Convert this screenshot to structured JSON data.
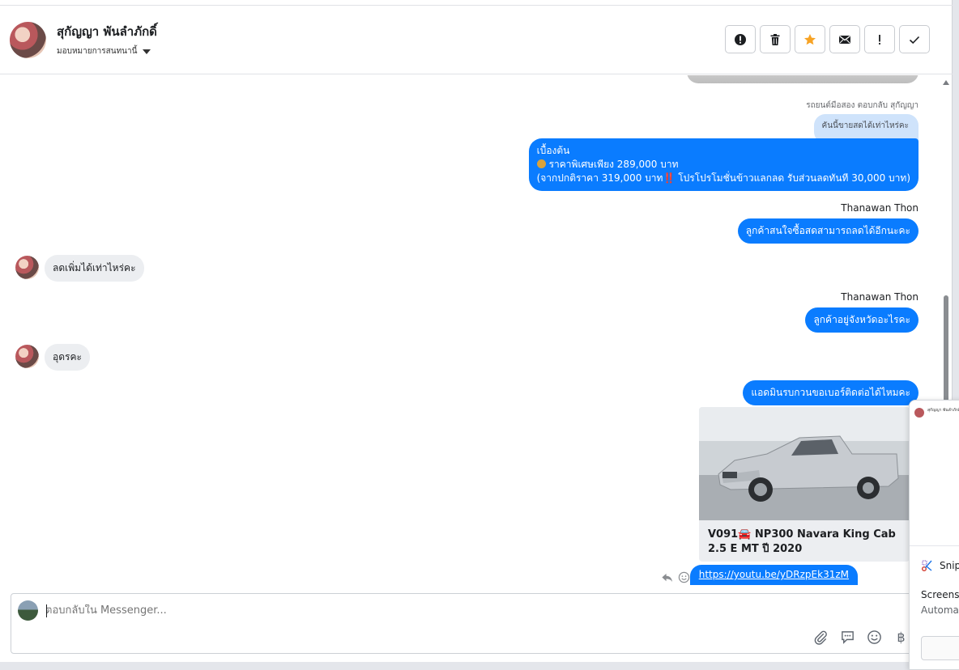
{
  "header": {
    "contact_name": "สุกัญญา พันลำภักดิ์",
    "assign_label": "มอบหมายการสนทนานี้",
    "toolbar": [
      {
        "icon": "alert-circle-icon",
        "label": "Report"
      },
      {
        "icon": "trash-icon",
        "label": "Delete"
      },
      {
        "icon": "star-icon",
        "label": "Star"
      },
      {
        "icon": "envelope-icon",
        "label": "Mark unread"
      },
      {
        "icon": "exclamation-icon",
        "label": "Follow up"
      },
      {
        "icon": "check-icon",
        "label": "Done"
      }
    ]
  },
  "thread": {
    "reply_note": "รถยนต์มือสอง ตอบกลับ สุกัญญา",
    "quoted_text": "คันนี้ขายสดได้เท่าไหร่คะ",
    "main_message": {
      "line1": "เบื้องต้น",
      "line2": "ราคาพิเศษเพียง 289,000 บาท",
      "line3_a": "(จากปกติราคา 319,000 บาท",
      "line3_b": "‼️",
      "line3_c": " โปรโปรโมชั่นข้าวแลกลด รับส่วนลดทันที 30,000 บาท)"
    },
    "sender_1": "Thanawan Thon",
    "msg_out_1": "ลูกค้าสนใจซื้อสดสามารถลดได้อีกนะคะ",
    "msg_in_1": "ลดเพิ่มได้เท่าไหร่คะ",
    "sender_2": "Thanawan Thon",
    "msg_out_2": "ลูกค้าอยู่จังหวัดอะไรคะ",
    "msg_in_2": "อุดรคะ",
    "msg_out_3": "แอดมินรบกวนขอเบอร์ติดต่อได้ไหมคะ",
    "card_title": "V091🚘 NP300 Navara King Cab 2.5 E MT ปี 2020",
    "link": "https://youtu.be/yDRzpEk31zM"
  },
  "composer": {
    "placeholder": "ตอบกลับใน Messenger...",
    "icons": [
      "paperclip-icon",
      "saved-reply-icon",
      "emoji-icon",
      "baht-icon"
    ],
    "baht_symbol": "฿"
  },
  "snip_notification": {
    "thumb_text": "สุกัญญา พันลำภักดิ์",
    "app_name": "Snip",
    "line1": "Screens",
    "line2": "Automa"
  },
  "colors": {
    "outgoing_bubble": "#0a7cff",
    "incoming_bubble": "#eceef1",
    "quoted_bubble": "#cfe3fb",
    "star": "#f7a325"
  }
}
